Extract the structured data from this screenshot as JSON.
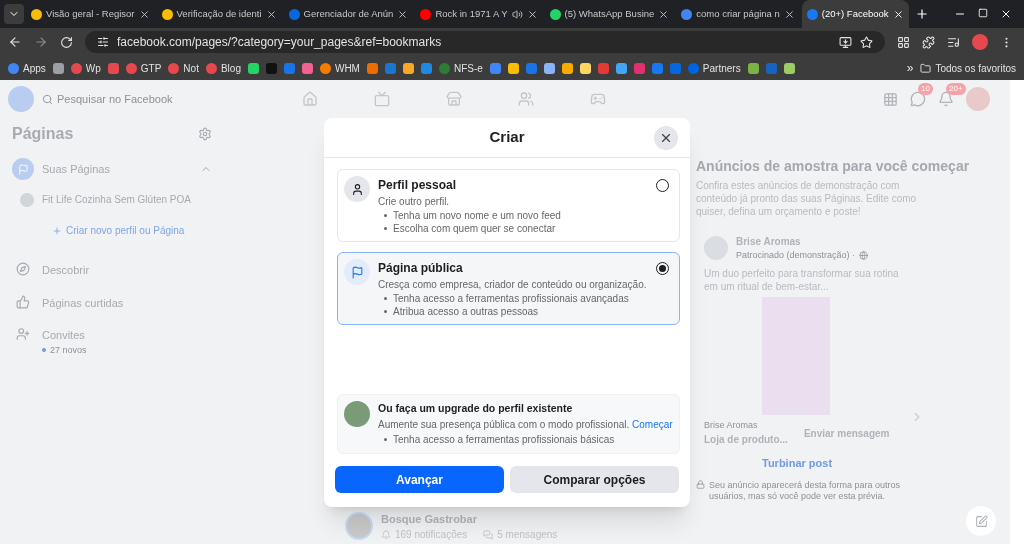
{
  "browser": {
    "tabs": [
      {
        "title": "Visão geral - Regisor",
        "color": "#fbbc04",
        "selected": false,
        "audio": false
      },
      {
        "title": "Verificação de identi",
        "color": "#fbbc04",
        "selected": false,
        "audio": false
      },
      {
        "title": "Gerenciador de Anún",
        "color": "#0668e1",
        "selected": false,
        "audio": false
      },
      {
        "title": "Rock in 1971 A Y",
        "color": "#ff0000",
        "selected": false,
        "audio": true
      },
      {
        "title": "(5) WhatsApp Busine",
        "color": "#25d366",
        "selected": false,
        "audio": false
      },
      {
        "title": "como criar página n",
        "color": "#4285f4",
        "selected": false,
        "audio": false
      },
      {
        "title": "(20+) Facebook",
        "color": "#1877f2",
        "selected": true,
        "audio": false
      }
    ],
    "address": "facebook.com/pages/?category=your_pages&ref=bookmarks",
    "bookmarks": [
      {
        "label": "Apps",
        "color": "#4285f4"
      },
      {
        "color": "#9aa0a6"
      },
      {
        "label": "Wp",
        "color": "#e5484d"
      },
      {
        "color": "#e5484d"
      },
      {
        "label": "GTP",
        "color": "#e5484d"
      },
      {
        "label": "Not",
        "color": "#e5484d"
      },
      {
        "label": "Blog",
        "color": "#e5484d"
      },
      {
        "color": "#25d366"
      },
      {
        "color": "#111111"
      },
      {
        "color": "#1a73e8"
      },
      {
        "color": "#f06292"
      },
      {
        "label": "WHM",
        "color": "#f57c00"
      },
      {
        "color": "#ef6c00"
      },
      {
        "color": "#1976d2"
      },
      {
        "color": "#f9a825"
      },
      {
        "color": "#1e88e5"
      },
      {
        "label": "NFS-e",
        "color": "#2e7d32"
      },
      {
        "color": "#4285f4"
      },
      {
        "color": "#fbbc04"
      },
      {
        "color": "#1a73e8"
      },
      {
        "color": "#8ab4f8"
      },
      {
        "color": "#f9ab00"
      },
      {
        "color": "#fdd663"
      },
      {
        "color": "#e53935"
      },
      {
        "color": "#42a5f5"
      },
      {
        "color": "#e1306c"
      },
      {
        "color": "#1877f2"
      },
      {
        "color": "#0668e1"
      },
      {
        "label": "Partners",
        "color": "#0064e0"
      },
      {
        "color": "#7cb342"
      },
      {
        "color": "#1565c0"
      },
      {
        "color": "#9ccc65"
      }
    ],
    "more": "»",
    "all_bookmarks": "Todos os favoritos"
  },
  "facebook": {
    "search": {
      "placeholder": "Pesquisar no Facebook"
    },
    "messenger_badge": "10",
    "notifications_badge": "20+",
    "sidebar": {
      "title": "Páginas",
      "section": {
        "label": "Suas Páginas",
        "expanded": true,
        "pages": [
          "Fit Life Cozinha Sem Glúten POA"
        ],
        "create": "Criar novo perfil ou Página"
      },
      "items": [
        {
          "kind": "discover",
          "label": "Descobrir"
        },
        {
          "kind": "liked",
          "label": "Páginas curtidas"
        },
        {
          "kind": "invites",
          "label": "Convites",
          "sub": "27 novos"
        }
      ]
    },
    "page_card": {
      "name": "Bosque Gastrobar",
      "notifications": "169 notificações",
      "messages": "5 mensagens"
    },
    "ads": {
      "title": "Anúncios de amostra para você começar",
      "text": "Confira estes anúncios de demonstração com conteúdo já pronto das suas Páginas. Edite como quiser, defina um orçamento e poste!",
      "advertiser": "Brise Aromas",
      "sponsored": "Patrocinado (demonstração) ·",
      "post": "Um duo perfeito para transformar sua rotina em um ritual de bem-estar...",
      "link_source": "Brise Aromas",
      "link_title": "Loja de produto...",
      "cta": "Enviar mensagem",
      "boost": "Turbinar post",
      "footer": "Seu anúncio aparecerá desta forma para outros usuários, mas só você pode ver esta prévia."
    }
  },
  "modal": {
    "title": "Criar",
    "options": [
      {
        "kind": "profile",
        "title": "Perfil pessoal",
        "subtitle": "Crie outro perfil.",
        "bullets": [
          "Tenha um novo nome e um novo feed",
          "Escolha com quem quer se conectar"
        ],
        "selected": false
      },
      {
        "kind": "page",
        "title": "Página pública",
        "subtitle": "Cresça como empresa, criador de conteúdo ou organização.",
        "bullets": [
          "Tenha acesso a ferramentas profissionais avançadas",
          "Atribua acesso a outras pessoas"
        ],
        "selected": true
      }
    ],
    "upgrade": {
      "title": "Ou faça um upgrade do perfil existente",
      "text": "Aumente sua presença pública com o modo profissional.",
      "link": "Começar",
      "bullets": [
        "Tenha acesso a ferramentas profissionais básicas"
      ]
    },
    "primary": "Avançar",
    "secondary": "Comparar opções"
  }
}
